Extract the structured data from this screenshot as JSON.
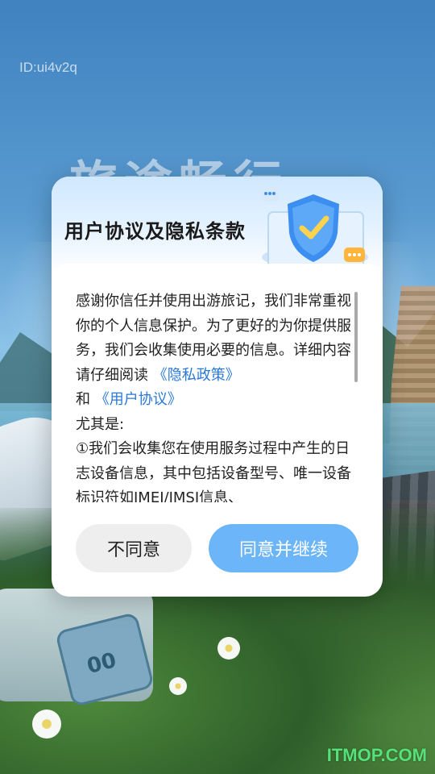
{
  "overlay": {
    "id_text": "ID:ui4v2q",
    "watermark": "ITMOP.COM"
  },
  "background": {
    "headline": "旅途畅行",
    "tag_text": "00"
  },
  "dialog": {
    "title": "用户协议及隐私条款",
    "body": {
      "intro": "感谢你信任并使用出游旅记，我们非常重视你的个人信息保护。为了更好的为你提供服务，我们会收集使用必要的信息。详细内容请仔细阅读",
      "privacy_link": "《隐私政策》",
      "conjunction": "和",
      "user_agreement_link": "《用户协议》",
      "especially": "尤其是:",
      "item_1": "①我们会收集您在使用服务过程中产生的日志设备信息，其中包括设备型号、唯一设备标识符如IMEI/IMSI信息、"
    },
    "buttons": {
      "disagree": "不同意",
      "agree": "同意并继续"
    },
    "colors": {
      "accent": "#6db5f9",
      "link": "#2a78d8"
    },
    "icons": {
      "header": "shield-check-icon"
    }
  }
}
